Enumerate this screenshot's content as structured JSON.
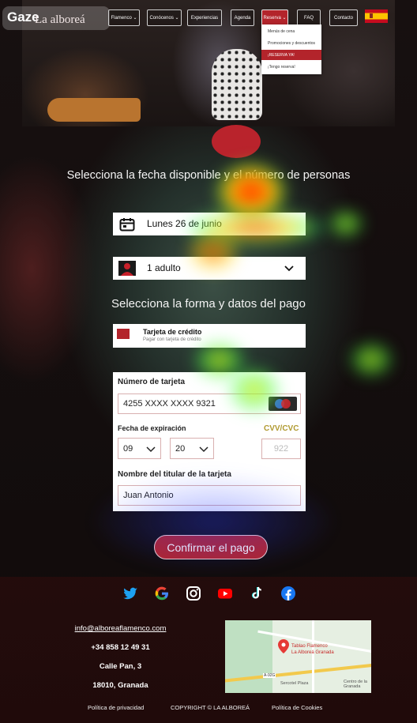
{
  "brand": {
    "overlay": "Gaze",
    "name": "La alboreá"
  },
  "nav": {
    "items": [
      {
        "label": "Flamenco ⌄"
      },
      {
        "label": "Conócenos ⌄"
      },
      {
        "label": "Experiencias"
      },
      {
        "label": "Agenda"
      },
      {
        "label": "Reserva ⌄"
      },
      {
        "label": "FAQ"
      },
      {
        "label": "Contacto"
      }
    ],
    "dropdown": [
      {
        "label": "Menús de cena"
      },
      {
        "label": "Promociones y descuentos"
      },
      {
        "label": "¡RESERVA YA!"
      },
      {
        "label": "¡Tengo reserva!"
      }
    ]
  },
  "booking": {
    "date_heading": "Selecciona la fecha disponible y el número de personas",
    "date_value": "Lunes 26 de junio",
    "people_value": "1 adulto",
    "payment_heading": "Selecciona la forma y datos del pago",
    "payment_method": {
      "title": "Tarjeta de crédito",
      "subtitle": "Pagar con tarjeta de crédito"
    }
  },
  "card_form": {
    "number_label": "Número de tarjeta",
    "number_value": "4255 XXXX XXXX 9321",
    "expiry_label": "Fecha de expiración",
    "month_value": "09",
    "year_value": "20",
    "cvv_label": "CVV/CVC",
    "cvv_value": "922",
    "holder_label": "Nombre del titular de la tarjeta",
    "holder_value": "Juan Antonio",
    "brand_icon": "maestro-icon"
  },
  "confirm_button": "Confirmar el pago",
  "footer": {
    "email": "info@alboreaflamenco.com",
    "phone": "+34 858 12 49 31",
    "address": "Calle Pan, 3",
    "city": "18010, Granada",
    "map_labels": [
      "Tablao Flamenco",
      "La Alboreá Granada",
      "Sercotel Plaza",
      "Centro de la Granada",
      "A-92G"
    ],
    "privacy": "Política de privacidad",
    "copyright": "COPYRIGHT © LA ALBOREÁ",
    "cookies": "Política de Cookies"
  },
  "colors": {
    "accent": "#b3242b",
    "social_twitter": "#1da1f2",
    "social_youtube": "#ff0000",
    "social_facebook": "#1877f2"
  }
}
